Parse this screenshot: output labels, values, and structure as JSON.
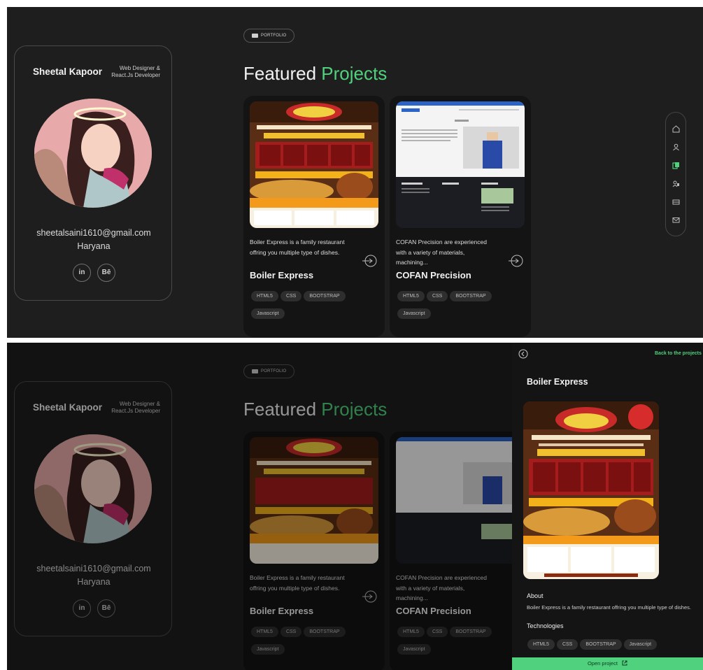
{
  "profile": {
    "name": "Sheetal Kapoor",
    "role_line1": "Web Designer &",
    "role_line2": "React.Js Developer",
    "email": "sheetalsaini1610@gmail.com",
    "location": "Haryana",
    "social": [
      {
        "label": "in"
      },
      {
        "label": "Bē"
      }
    ]
  },
  "section": {
    "badge": "PORTFOLIO",
    "title_main": "Featured ",
    "title_accent": "Projects"
  },
  "projects": [
    {
      "title": "Boiler Express",
      "description": "Boiler Express is a family restaurant offring you multiple type of dishes.",
      "tags": [
        "HTML5",
        "CSS",
        "BOOTSTRAP",
        "Javascript"
      ]
    },
    {
      "title": "COFAN Precision",
      "description": "COFAN Precision are experienced with a variety of materials, machining...",
      "tags": [
        "HTML5",
        "CSS",
        "BOOTSTRAP",
        "Javascript"
      ]
    }
  ],
  "panel": {
    "back_link": "Back to the projects",
    "title": "Boiler Express",
    "about_heading": "About",
    "about_text": "Boiler Express is a family restaurant offring you multiple type of dishes.",
    "tech_heading": "Technologies",
    "tags": [
      "HTML5",
      "CSS",
      "BOOTSTRAP",
      "Javascript"
    ],
    "open_label": "Open project"
  },
  "nav_icons": [
    "home-icon",
    "user-icon",
    "portfolio-icon",
    "services-icon",
    "resume-icon",
    "contact-icon"
  ],
  "colors": {
    "accent": "#4fd17d",
    "background": "#1e1e1e",
    "card": "#141414"
  }
}
